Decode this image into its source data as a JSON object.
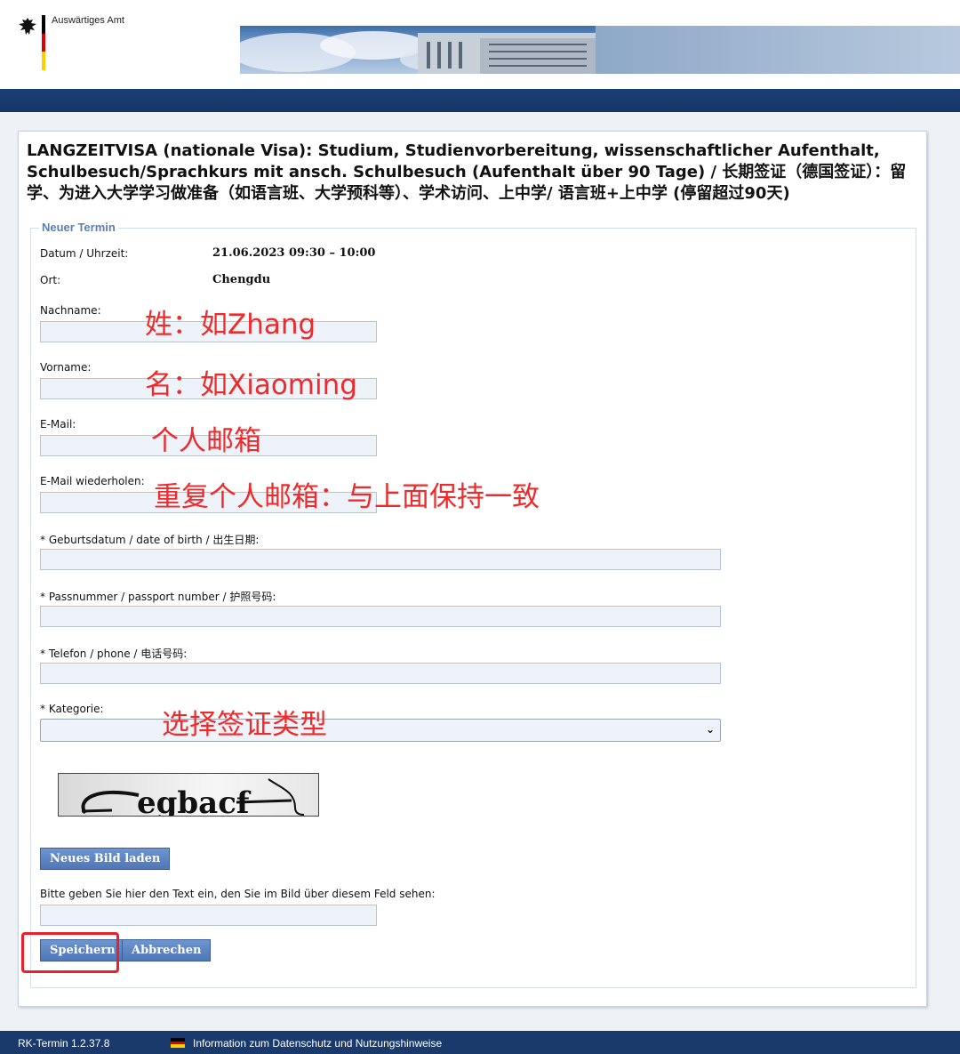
{
  "header": {
    "agency": "Auswärtiges Amt"
  },
  "page": {
    "title": "LANGZEITVISA (nationale Visa): Studium, Studienvorbereitung, wissenschaftlicher Aufenthalt, Schulbesuch/Sprachkurs mit ansch. Schulbesuch (Aufenthalt über 90 Tage) / 长期签证（德国签证）：留学、为进入大学学习做准备（如语言班、大学预科等）、学术访问、上中学/ 语言班+上中学 (停留超过90天)"
  },
  "form": {
    "legend": "Neuer Termin",
    "datetime_label": "Datum / Uhrzeit:",
    "datetime_value": "21.06.2023 09:30 – 10:00",
    "location_label": "Ort:",
    "location_value": "Chengdu",
    "lastname_label": "Nachname:",
    "lastname_value": "",
    "firstname_label": "Vorname:",
    "firstname_value": "",
    "email_label": "E-Mail:",
    "email_value": "",
    "email_repeat_label": "E-Mail wiederholen:",
    "email_repeat_value": "",
    "birthdate_label": "* Geburtsdatum / date of birth / 出生日期:",
    "birthdate_value": "",
    "passport_label": "* Passnummer / passport number / 护照号码:",
    "passport_value": "",
    "phone_label": "* Telefon / phone / 电话号码:",
    "phone_value": "",
    "category_label": "* Kategorie:",
    "category_selected": "",
    "captcha_text": "egbacf",
    "reload_button": "Neues Bild laden",
    "captcha_prompt": "Bitte geben Sie hier den Text ein, den Sie im Bild über diesem Feld sehen:",
    "captcha_value": "",
    "save_button": "Speichern",
    "cancel_button": "Abbrechen"
  },
  "annotations": {
    "lastname": "姓：如Zhang",
    "firstname": "名：如Xiaoming",
    "email": "个人邮箱",
    "email_repeat": "重复个人邮箱：与上面保持一致",
    "category": "选择签证类型",
    "highlight_color": "#e8202a"
  },
  "footer": {
    "version": "RK-Termin 1.2.37.8",
    "privacy_link": "Information zum Datenschutz und Nutzungshinweise"
  }
}
